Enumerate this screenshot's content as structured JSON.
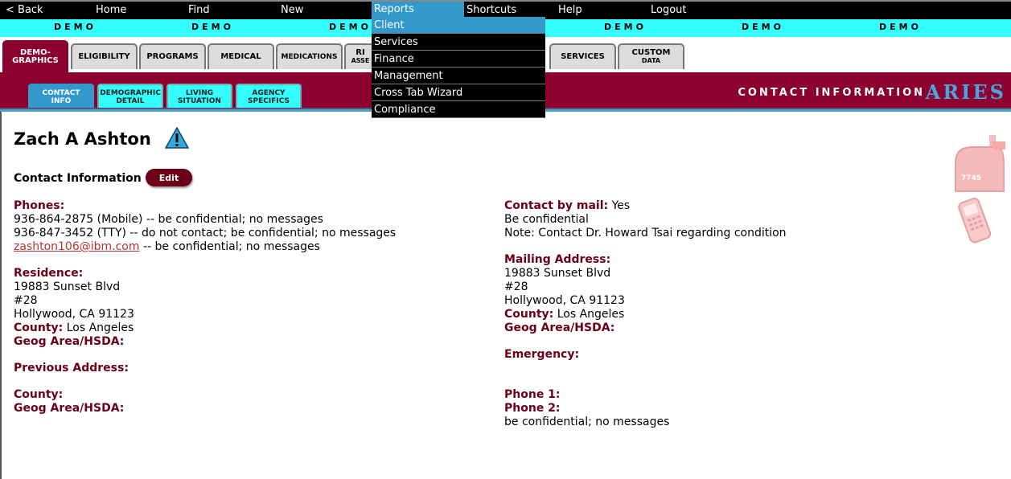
{
  "menu": {
    "back": "< Back",
    "home": "Home",
    "find": "Find",
    "new": "New",
    "reports": "Reports",
    "shortcuts": "Shortcuts",
    "help": "Help",
    "logout": "Logout"
  },
  "reports_dropdown": [
    "Client",
    "Services",
    "Finance",
    "Management",
    "Cross Tab Wizard",
    "Compliance"
  ],
  "demo_label": "DEMO",
  "main_tabs": {
    "demographics": [
      "DEMO-",
      "GRAPHICS"
    ],
    "eligibility": "ELIGIBILITY",
    "programs": "PROGRAMS",
    "medical": "MEDICAL",
    "medications": "MEDICATIONS",
    "risk": [
      "RI",
      "ASSE"
    ],
    "services": "SERVICES",
    "custom": [
      "CUSTOM",
      "DATA"
    ]
  },
  "sub_tabs": {
    "contact_info": [
      "CONTACT",
      "INFO"
    ],
    "demographic_detail": [
      "DEMOGRAPHIC",
      "DETAIL"
    ],
    "living_situation": [
      "LIVING",
      "SITUATION"
    ],
    "agency_specifics": [
      "AGENCY",
      "SPECIFICS"
    ]
  },
  "section_title": "CONTACT INFORMATION",
  "logo": "ARIES",
  "client_name": "Zach A Ashton",
  "contact_information_label": "Contact Information",
  "edit_label": "Edit",
  "left": {
    "phones_label": "Phones:",
    "phone1": "936-864-2875 (Mobile) -- be confidential; no messages",
    "phone2": "936-847-3452 (TTY) -- do not contact; be confidential; no messages",
    "email": "zashton106@ibm.com",
    "email_note": " -- be confidential; no messages",
    "residence_label": "Residence:",
    "res_line1": "19883 Sunset Blvd",
    "res_line2": "#28",
    "res_line3": "Hollywood, CA 91123",
    "county_label": "County:",
    "county_value": " Los Angeles",
    "geog_label": "Geog Area/HSDA:",
    "prev_address_label": "Previous Address:",
    "prev_county_label": "County:",
    "prev_geog_label": "Geog Area/HSDA:"
  },
  "right": {
    "contact_mail_label": "Contact by mail:",
    "contact_mail_value": " Yes",
    "confidential": "Be confidential",
    "note": "Note: Contact Dr. Howard Tsai regarding condition",
    "mailing_label": "Mailing Address:",
    "mail_line1": "19883 Sunset Blvd",
    "mail_line2": "#28",
    "mail_line3": "Hollywood, CA 91123",
    "county_label": "County:",
    "county_value": " Los Angeles",
    "geog_label": "Geog Area/HSDA:",
    "emergency_label": "Emergency:",
    "phone1_label": "Phone 1:",
    "phone2_label": "Phone 2:",
    "phone2_note": "be confidential; no messages"
  },
  "mailbox_text": "7745"
}
